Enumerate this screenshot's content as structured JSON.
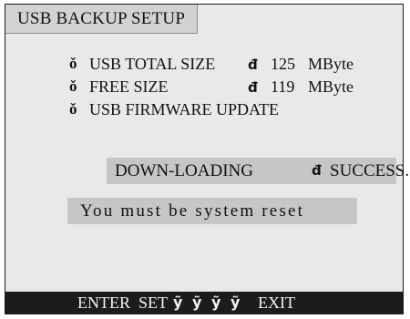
{
  "window": {
    "title": "USB BACKUP SETUP"
  },
  "info": {
    "bullet_icon": "check-diamond-icon",
    "arrow_icon": "arrow-right-icon",
    "bullet_glyph": "ě",
    "arrow_glyph": "đ",
    "total_size_label": "USB TOTAL SIZE",
    "total_size_value": "125",
    "total_size_unit": "MByte",
    "free_size_label": "FREE SIZE",
    "free_size_value": "119",
    "free_size_unit": "MByte",
    "firmware_label": "USB FIRMWARE UPDATE"
  },
  "status": {
    "action": "DOWN-LOADING",
    "result": "SUCCESS..."
  },
  "message": {
    "text": "You must be system reset"
  },
  "footer": {
    "enter_label": "ENTER",
    "set_label": "SET",
    "up_key": "¥̌",
    "down_key": "ŷ̌",
    "left_key": "Ŵ̌",
    "right_key": "¥̌",
    "exit_label": "EXIT",
    "key_icons": [
      "up-key-icon",
      "down-key-icon",
      "left-key-icon",
      "right-key-icon"
    ]
  },
  "colors": {
    "panel_bg": "#e9e9e9",
    "bar_bg": "#c6c6c6",
    "footer_bg": "#1c1c1c",
    "footer_text": "#f2f2f2"
  }
}
